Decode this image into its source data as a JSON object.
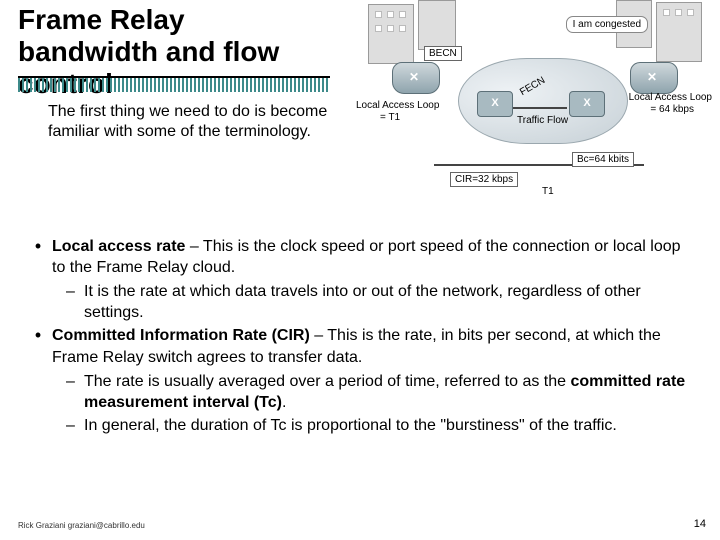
{
  "title": "Frame Relay bandwidth and flow control",
  "intro": "The first thing we need to do is become familiar with some of the terminology.",
  "diagram": {
    "callout": "I am congested",
    "becn": "BECN",
    "fecn": "FECN",
    "traffic": "Traffic Flow",
    "lal_left_a": "Local Access Loop",
    "lal_left_b": "= T1",
    "lal_right_a": "Local Access Loop",
    "lal_right_b": "= 64 kbps",
    "cir": "CIR=32 kbps",
    "bc": "Bc=64 kbits",
    "t1": "T1"
  },
  "bullets": {
    "b1_bold": "Local access rate",
    "b1_rest": " – This is the clock speed or port speed of the connection or local loop to the Frame Relay cloud.",
    "b1_s1": "It is the rate at which data travels into or out of the network, regardless of other settings.",
    "b2_bold": "Committed Information Rate (CIR)",
    "b2_rest": " – This is the rate, in bits per second, at which the Frame Relay switch agrees to transfer data.",
    "b2_s1a": "The rate is usually averaged over a period of time, referred to as the ",
    "b2_s1b": "committed rate measurement interval (Tc)",
    "b2_s1c": ".",
    "b2_s2": "In general, the duration of Tc is proportional to the \"burstiness\" of the traffic."
  },
  "footer": {
    "left": "Rick Graziani  graziani@cabrillo.edu",
    "page": "14"
  }
}
